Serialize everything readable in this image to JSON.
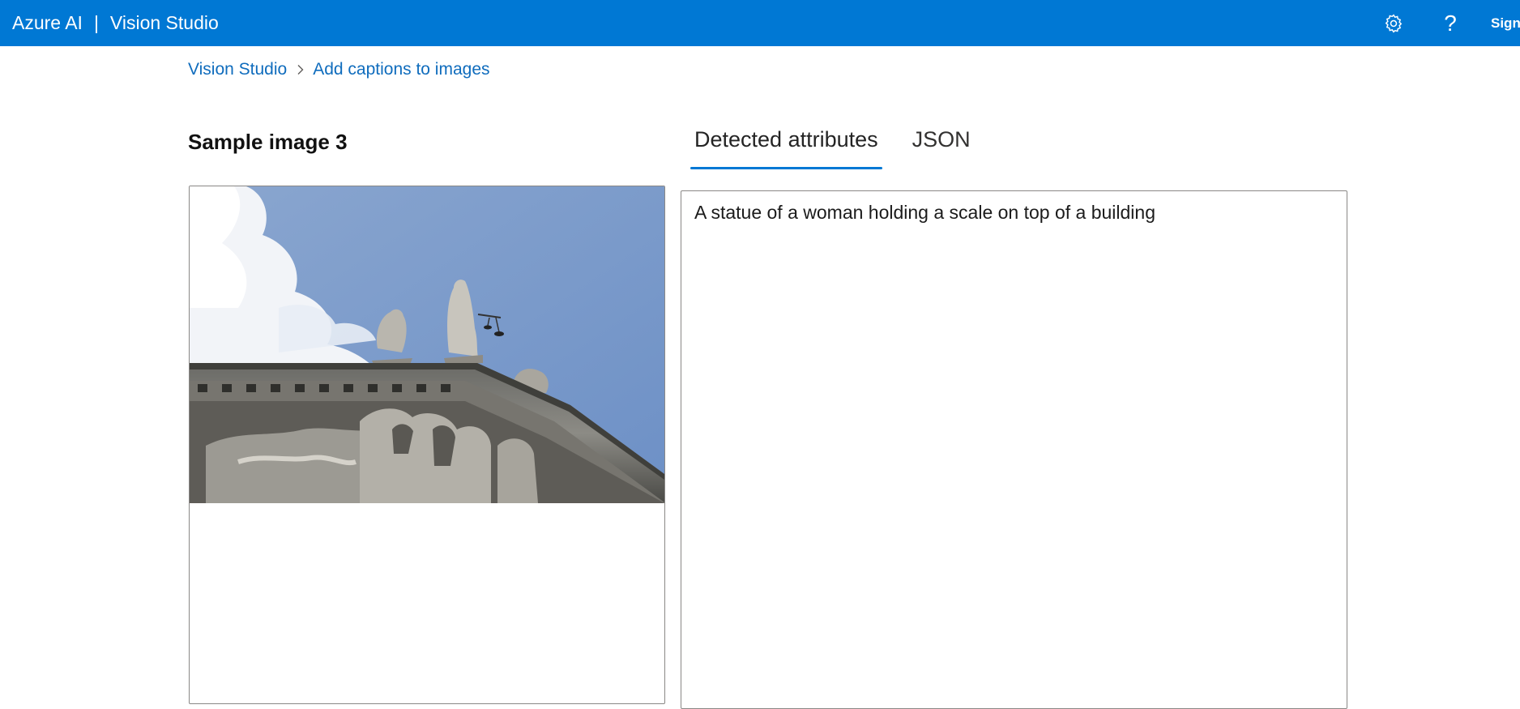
{
  "header": {
    "brand": "Azure AI",
    "separator": "|",
    "product": "Vision Studio",
    "settings_icon": "gear-icon",
    "help_icon": "help-icon",
    "help_glyph": "?",
    "signin_label": "Sign in"
  },
  "breadcrumb": {
    "items": [
      "Vision Studio",
      "Add captions to images"
    ],
    "separator_icon": "chevron-right-icon"
  },
  "sample": {
    "title": "Sample image 3",
    "image_icon": "sample-photo"
  },
  "tabs": [
    {
      "label": "Detected attributes",
      "active": true
    },
    {
      "label": "JSON",
      "active": false
    }
  ],
  "result": {
    "caption": "A statue of a woman holding a scale on top of a building"
  },
  "colors": {
    "accent": "#0078d4",
    "link": "#0f6cbd"
  }
}
